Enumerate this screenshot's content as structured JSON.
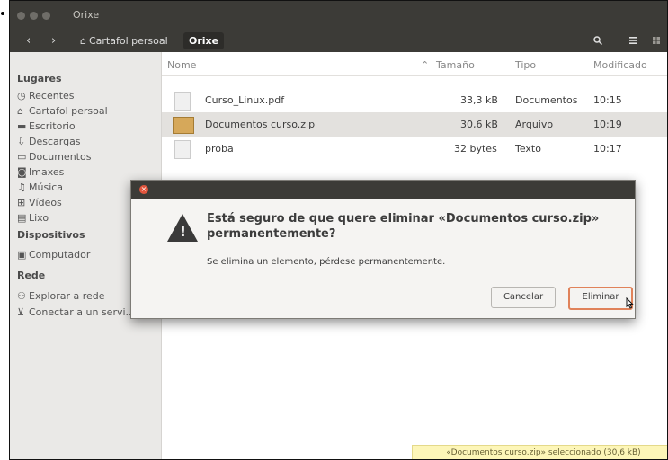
{
  "window": {
    "title": "Orixe"
  },
  "toolbar": {
    "home_crumb": "Cartafol persoal",
    "current_crumb": "Orixe",
    "back_icon": "‹",
    "forward_icon": "›",
    "search_icon": "search-icon",
    "menu_icon": "hamburger-icon"
  },
  "sidebar": {
    "places_header": "Lugares",
    "places": [
      {
        "label": "Recentes",
        "icon": "◷"
      },
      {
        "label": "Cartafol persoal",
        "icon": "⌂"
      },
      {
        "label": "Escritorio",
        "icon": "▬"
      },
      {
        "label": "Descargas",
        "icon": "⇩"
      },
      {
        "label": "Documentos",
        "icon": "▭"
      },
      {
        "label": "Imaxes",
        "icon": "◙"
      },
      {
        "label": "Música",
        "icon": "♫"
      },
      {
        "label": "Vídeos",
        "icon": "⊞"
      },
      {
        "label": "Lixo",
        "icon": "▤"
      }
    ],
    "devices_header": "Dispositivos",
    "devices": [
      {
        "label": "Computador",
        "icon": "▣"
      }
    ],
    "network_header": "Rede",
    "network": [
      {
        "label": "Explorar a rede",
        "icon": "⚇"
      },
      {
        "label": "Conectar a un servi...",
        "icon": "⊻"
      }
    ]
  },
  "list": {
    "columns": {
      "name": "Nome",
      "size": "Tamaño",
      "type": "Tipo",
      "modified": "Modificado"
    },
    "rows": [
      {
        "name": "Curso_Linux.pdf",
        "size": "33,3 kB",
        "type": "Documentos",
        "modified": "10:15"
      },
      {
        "name": "Documentos curso.zip",
        "size": "30,6 kB",
        "type": "Arquivo",
        "modified": "10:19"
      },
      {
        "name": "proba",
        "size": "32 bytes",
        "type": "Texto",
        "modified": "10:17"
      }
    ]
  },
  "dialog": {
    "title": "Está seguro de que quere eliminar «Documentos curso.zip» permanentemente?",
    "message": "Se elimina un elemento, pérdese permanentemente.",
    "cancel": "Cancelar",
    "delete": "Eliminar"
  },
  "status": "«Documentos curso.zip» seleccionado (30,6 kB)"
}
